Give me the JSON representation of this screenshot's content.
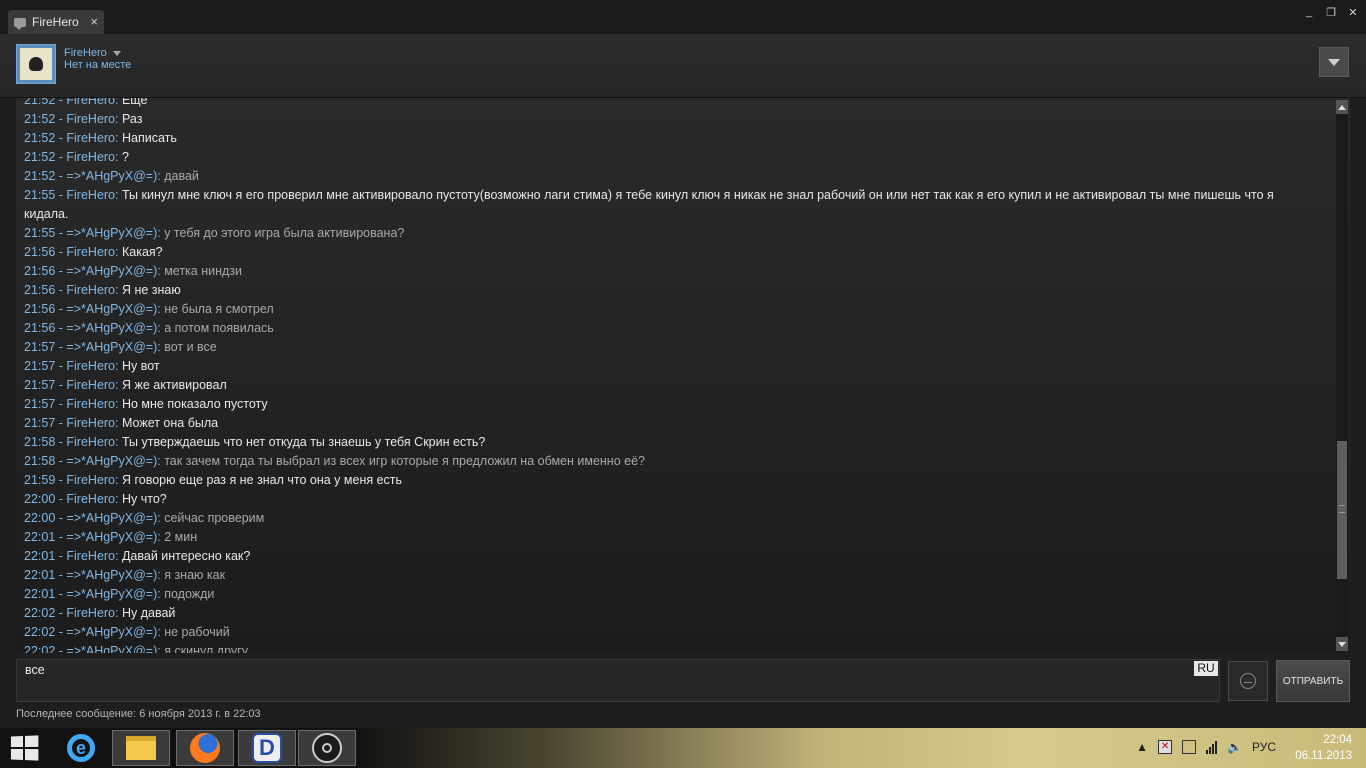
{
  "window": {
    "tab_title": "FireHero",
    "tab_close": "×",
    "btn_minimize": "_",
    "btn_restore": "❐",
    "btn_close": "✕"
  },
  "header": {
    "name": "FireHero",
    "status": "Нет на месте"
  },
  "chat": {
    "messages": [
      {
        "time": "21:52",
        "user": "FireHero",
        "self": true,
        "text": "Еще"
      },
      {
        "time": "21:52",
        "user": "FireHero",
        "self": true,
        "text": "Раз"
      },
      {
        "time": "21:52",
        "user": "FireHero",
        "self": true,
        "text": "Написать"
      },
      {
        "time": "21:52",
        "user": "FireHero",
        "self": true,
        "text": "?"
      },
      {
        "time": "21:52",
        "user": "=>*AHgPyX@=)",
        "self": false,
        "text": "давай"
      },
      {
        "time": "21:55",
        "user": "FireHero",
        "self": true,
        "text": "Ты кинул мне ключ я его проверил мне активировало пустоту(возможно лаги стима) я тебе кинул ключ я никак не знал рабочий он или нет так как я его купил и не активировал ты мне пишешь что я кидала."
      },
      {
        "time": "21:55",
        "user": "=>*AHgPyX@=)",
        "self": false,
        "text": "у тебя до этого игра была активирована?"
      },
      {
        "time": "21:56",
        "user": "FireHero",
        "self": true,
        "text": "Какая?"
      },
      {
        "time": "21:56",
        "user": "=>*AHgPyX@=)",
        "self": false,
        "text": "метка ниндзи"
      },
      {
        "time": "21:56",
        "user": "FireHero",
        "self": true,
        "text": "Я не знаю"
      },
      {
        "time": "21:56",
        "user": "=>*AHgPyX@=)",
        "self": false,
        "text": "не была я смотрел"
      },
      {
        "time": "21:56",
        "user": "=>*AHgPyX@=)",
        "self": false,
        "text": "а потом появилась"
      },
      {
        "time": "21:57",
        "user": "=>*AHgPyX@=)",
        "self": false,
        "text": "вот и все"
      },
      {
        "time": "21:57",
        "user": "FireHero",
        "self": true,
        "text": "Ну вот"
      },
      {
        "time": "21:57",
        "user": "FireHero",
        "self": true,
        "text": "Я же активировал"
      },
      {
        "time": "21:57",
        "user": "FireHero",
        "self": true,
        "text": "Но мне показало пустоту"
      },
      {
        "time": "21:57",
        "user": "FireHero",
        "self": true,
        "text": "Может она была"
      },
      {
        "time": "21:58",
        "user": "FireHero",
        "self": true,
        "text": "Ты утверждаешь что нет откуда ты знаешь у тебя Скрин есть?"
      },
      {
        "time": "21:58",
        "user": "=>*AHgPyX@=)",
        "self": false,
        "text": "так зачем тогда ты выбрал из всех игр которые я предложил на обмен именно её?"
      },
      {
        "time": "21:59",
        "user": "FireHero",
        "self": true,
        "text": "Я говорю еще раз я не знал что она у меня есть"
      },
      {
        "time": "22:00",
        "user": "FireHero",
        "self": true,
        "text": "Ну что?"
      },
      {
        "time": "22:00",
        "user": "=>*AHgPyX@=)",
        "self": false,
        "text": "сейчас проверим"
      },
      {
        "time": "22:01",
        "user": "=>*AHgPyX@=)",
        "self": false,
        "text": "2 мин"
      },
      {
        "time": "22:01",
        "user": "FireHero",
        "self": true,
        "text": "Давай интересно как?"
      },
      {
        "time": "22:01",
        "user": "=>*AHgPyX@=)",
        "self": false,
        "text": "я знаю как"
      },
      {
        "time": "22:01",
        "user": "=>*AHgPyX@=)",
        "self": false,
        "text": "подожди"
      },
      {
        "time": "22:02",
        "user": "FireHero",
        "self": true,
        "text": "Ну давай"
      },
      {
        "time": "22:02",
        "user": "=>*AHgPyX@=)",
        "self": false,
        "text": "не рабочий"
      },
      {
        "time": "22:02",
        "user": "=>*AHgPyX@=)",
        "self": false,
        "text": "я скинул другу"
      }
    ],
    "scroll_position": 0.85
  },
  "composer": {
    "value": "все",
    "lang": "RU",
    "send_label": "ОТПРАВИТЬ"
  },
  "footer": {
    "last_message": "Последнее сообщение: 6 ноября 2013 г. в 22:03"
  },
  "taskbar": {
    "apps": [
      "windows-start",
      "internet-explorer",
      "file-explorer",
      "firefox",
      "dpad-app",
      "steam"
    ],
    "lang": "РУС",
    "time": "22:04",
    "date": "06.11.2013",
    "tray_show_hidden": "▲"
  }
}
